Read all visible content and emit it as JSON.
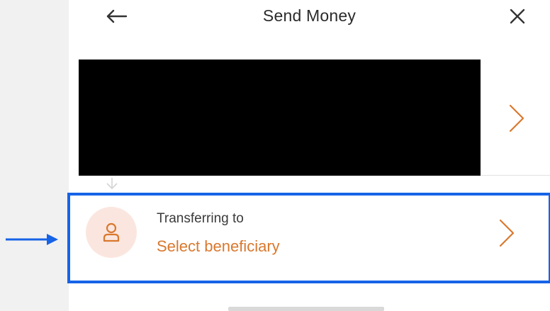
{
  "header": {
    "title": "Send Money",
    "back_icon": "arrow-left-icon",
    "close_icon": "close-icon"
  },
  "source_account": {
    "redacted": true,
    "chevron_icon": "chevron-right-icon"
  },
  "beneficiary": {
    "label": "Transferring to",
    "value": "Select beneficiary",
    "avatar_icon": "person-icon",
    "chevron_icon": "chevron-right-icon"
  },
  "annotation": {
    "highlight_color": "#1663e6",
    "pointer_icon": "arrow-right-icon"
  },
  "colors": {
    "accent": "#d9782e",
    "avatar_bg": "#fbe6df",
    "text_primary": "#2b2b2b"
  }
}
